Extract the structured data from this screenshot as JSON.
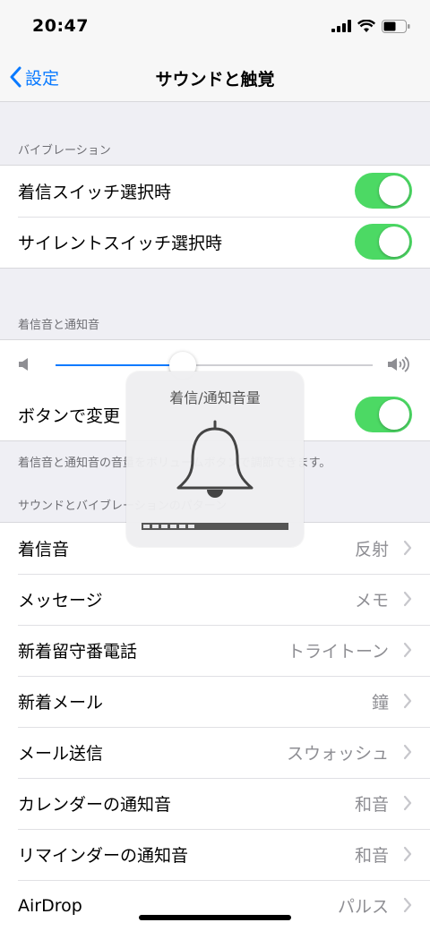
{
  "status_bar": {
    "time": "20:47"
  },
  "nav": {
    "back_label": "設定",
    "title": "サウンドと触覚"
  },
  "vibration": {
    "header": "バイブレーション",
    "items": [
      {
        "label": "着信スイッチ選択時",
        "on": true
      },
      {
        "label": "サイレントスイッチ選択時",
        "on": true
      }
    ]
  },
  "ringer": {
    "header": "着信音と通知音",
    "volume_level": 0.4,
    "change_with_buttons": {
      "label": "ボタンで変更",
      "on": true
    },
    "footer": "着信音と通知音の音量をボリュームボタンで調節できます。"
  },
  "patterns": {
    "header": "サウンドとバイブレーションのパターン",
    "items": [
      {
        "label": "着信音",
        "value": "反射"
      },
      {
        "label": "メッセージ",
        "value": "メモ"
      },
      {
        "label": "新着留守番電話",
        "value": "トライトーン"
      },
      {
        "label": "新着メール",
        "value": "鐘"
      },
      {
        "label": "メール送信",
        "value": "スウォッシュ"
      },
      {
        "label": "カレンダーの通知音",
        "value": "和音"
      },
      {
        "label": "リマインダーの通知音",
        "value": "和音"
      },
      {
        "label": "AirDrop",
        "value": "パルス"
      }
    ]
  },
  "hud": {
    "title": "着信/通知音量",
    "level": 0.4
  },
  "colors": {
    "accent": "#0a7aff",
    "toggle_on": "#4cd964"
  }
}
